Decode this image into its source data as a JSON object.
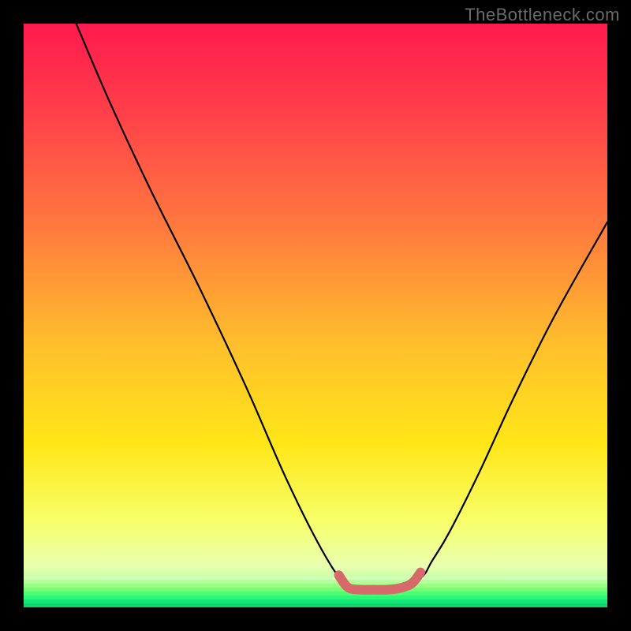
{
  "watermark": "TheBottleneck.com",
  "chart_data": {
    "type": "line",
    "title": "",
    "xlabel": "",
    "ylabel": "",
    "xlim": [
      0,
      100
    ],
    "ylim": [
      0,
      100
    ],
    "background": {
      "gradient_stops": [
        {
          "pos": 0.0,
          "color": "#ff1a4e"
        },
        {
          "pos": 0.15,
          "color": "#ff3f4a"
        },
        {
          "pos": 0.35,
          "color": "#ff7a3e"
        },
        {
          "pos": 0.55,
          "color": "#ffbf2c"
        },
        {
          "pos": 0.72,
          "color": "#ffe618"
        },
        {
          "pos": 0.85,
          "color": "#f7ff68"
        },
        {
          "pos": 0.93,
          "color": "#e9ffb0"
        },
        {
          "pos": 1.0,
          "color": "#6bff8c"
        }
      ],
      "green_band": {
        "from_y": 95,
        "to_y": 100,
        "stripes": [
          "#cfffb3",
          "#b4ff9a",
          "#97ff82",
          "#74ff73",
          "#4cff74",
          "#29f978",
          "#14e877",
          "#0dd66f"
        ]
      }
    },
    "series": [
      {
        "name": "bottleneck-curve",
        "color": "#000000",
        "x": [
          9,
          15,
          22,
          30,
          38,
          45,
          51,
          55,
          57.5,
          60,
          64,
          68,
          70,
          73,
          78,
          84,
          91,
          100
        ],
        "y": [
          100,
          86,
          71,
          55,
          38,
          22,
          10,
          4,
          3,
          3,
          3.5,
          5,
          8,
          13,
          23,
          36,
          50,
          66
        ]
      },
      {
        "name": "sweet-spot-marker",
        "color": "#d66a6a",
        "style": "thick-rounded",
        "x": [
          54,
          55,
          56,
          58,
          60,
          62,
          64,
          66,
          67,
          68
        ],
        "y": [
          5.5,
          4,
          3.2,
          3,
          3,
          3,
          3.2,
          3.8,
          4.6,
          6
        ]
      }
    ]
  }
}
